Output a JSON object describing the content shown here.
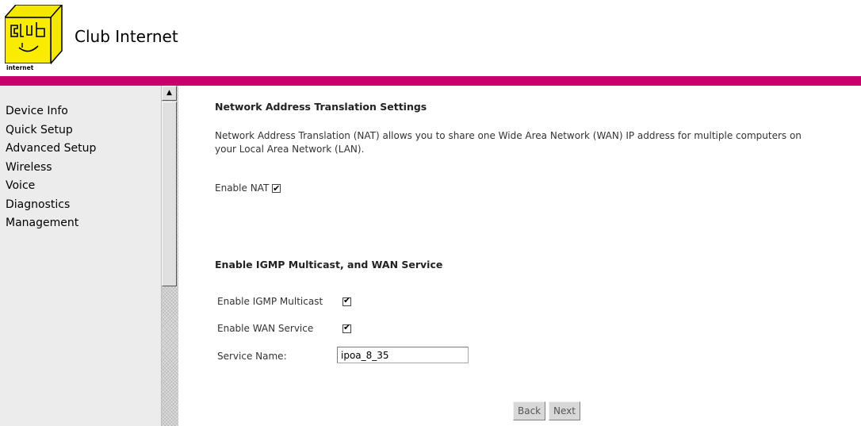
{
  "header": {
    "brand_name": "Club Internet",
    "logo_text": "internet",
    "accent_color": "#c8006e"
  },
  "sidebar": {
    "items": [
      {
        "label": "Device Info"
      },
      {
        "label": "Quick Setup"
      },
      {
        "label": "Advanced Setup"
      },
      {
        "label": "Wireless"
      },
      {
        "label": "Voice"
      },
      {
        "label": "Diagnostics"
      },
      {
        "label": "Management"
      }
    ]
  },
  "nat": {
    "title": "Network Address Translation Settings",
    "description_line1": "Network Address Translation (NAT) allows you to share one Wide Area Network (WAN) IP address for multiple computers on",
    "description_line2": "your Local Area Network (LAN).",
    "enable_nat_label": "Enable NAT",
    "enable_nat_checked": true
  },
  "igmp": {
    "title": "Enable IGMP Multicast, and WAN Service",
    "igmp_label": "Enable IGMP Multicast",
    "igmp_checked": true,
    "wan_label": "Enable WAN Service",
    "wan_checked": true,
    "service_name_label": "Service Name:",
    "service_name_value": "ipoa_8_35"
  },
  "buttons": {
    "back": "Back",
    "next": "Next"
  }
}
